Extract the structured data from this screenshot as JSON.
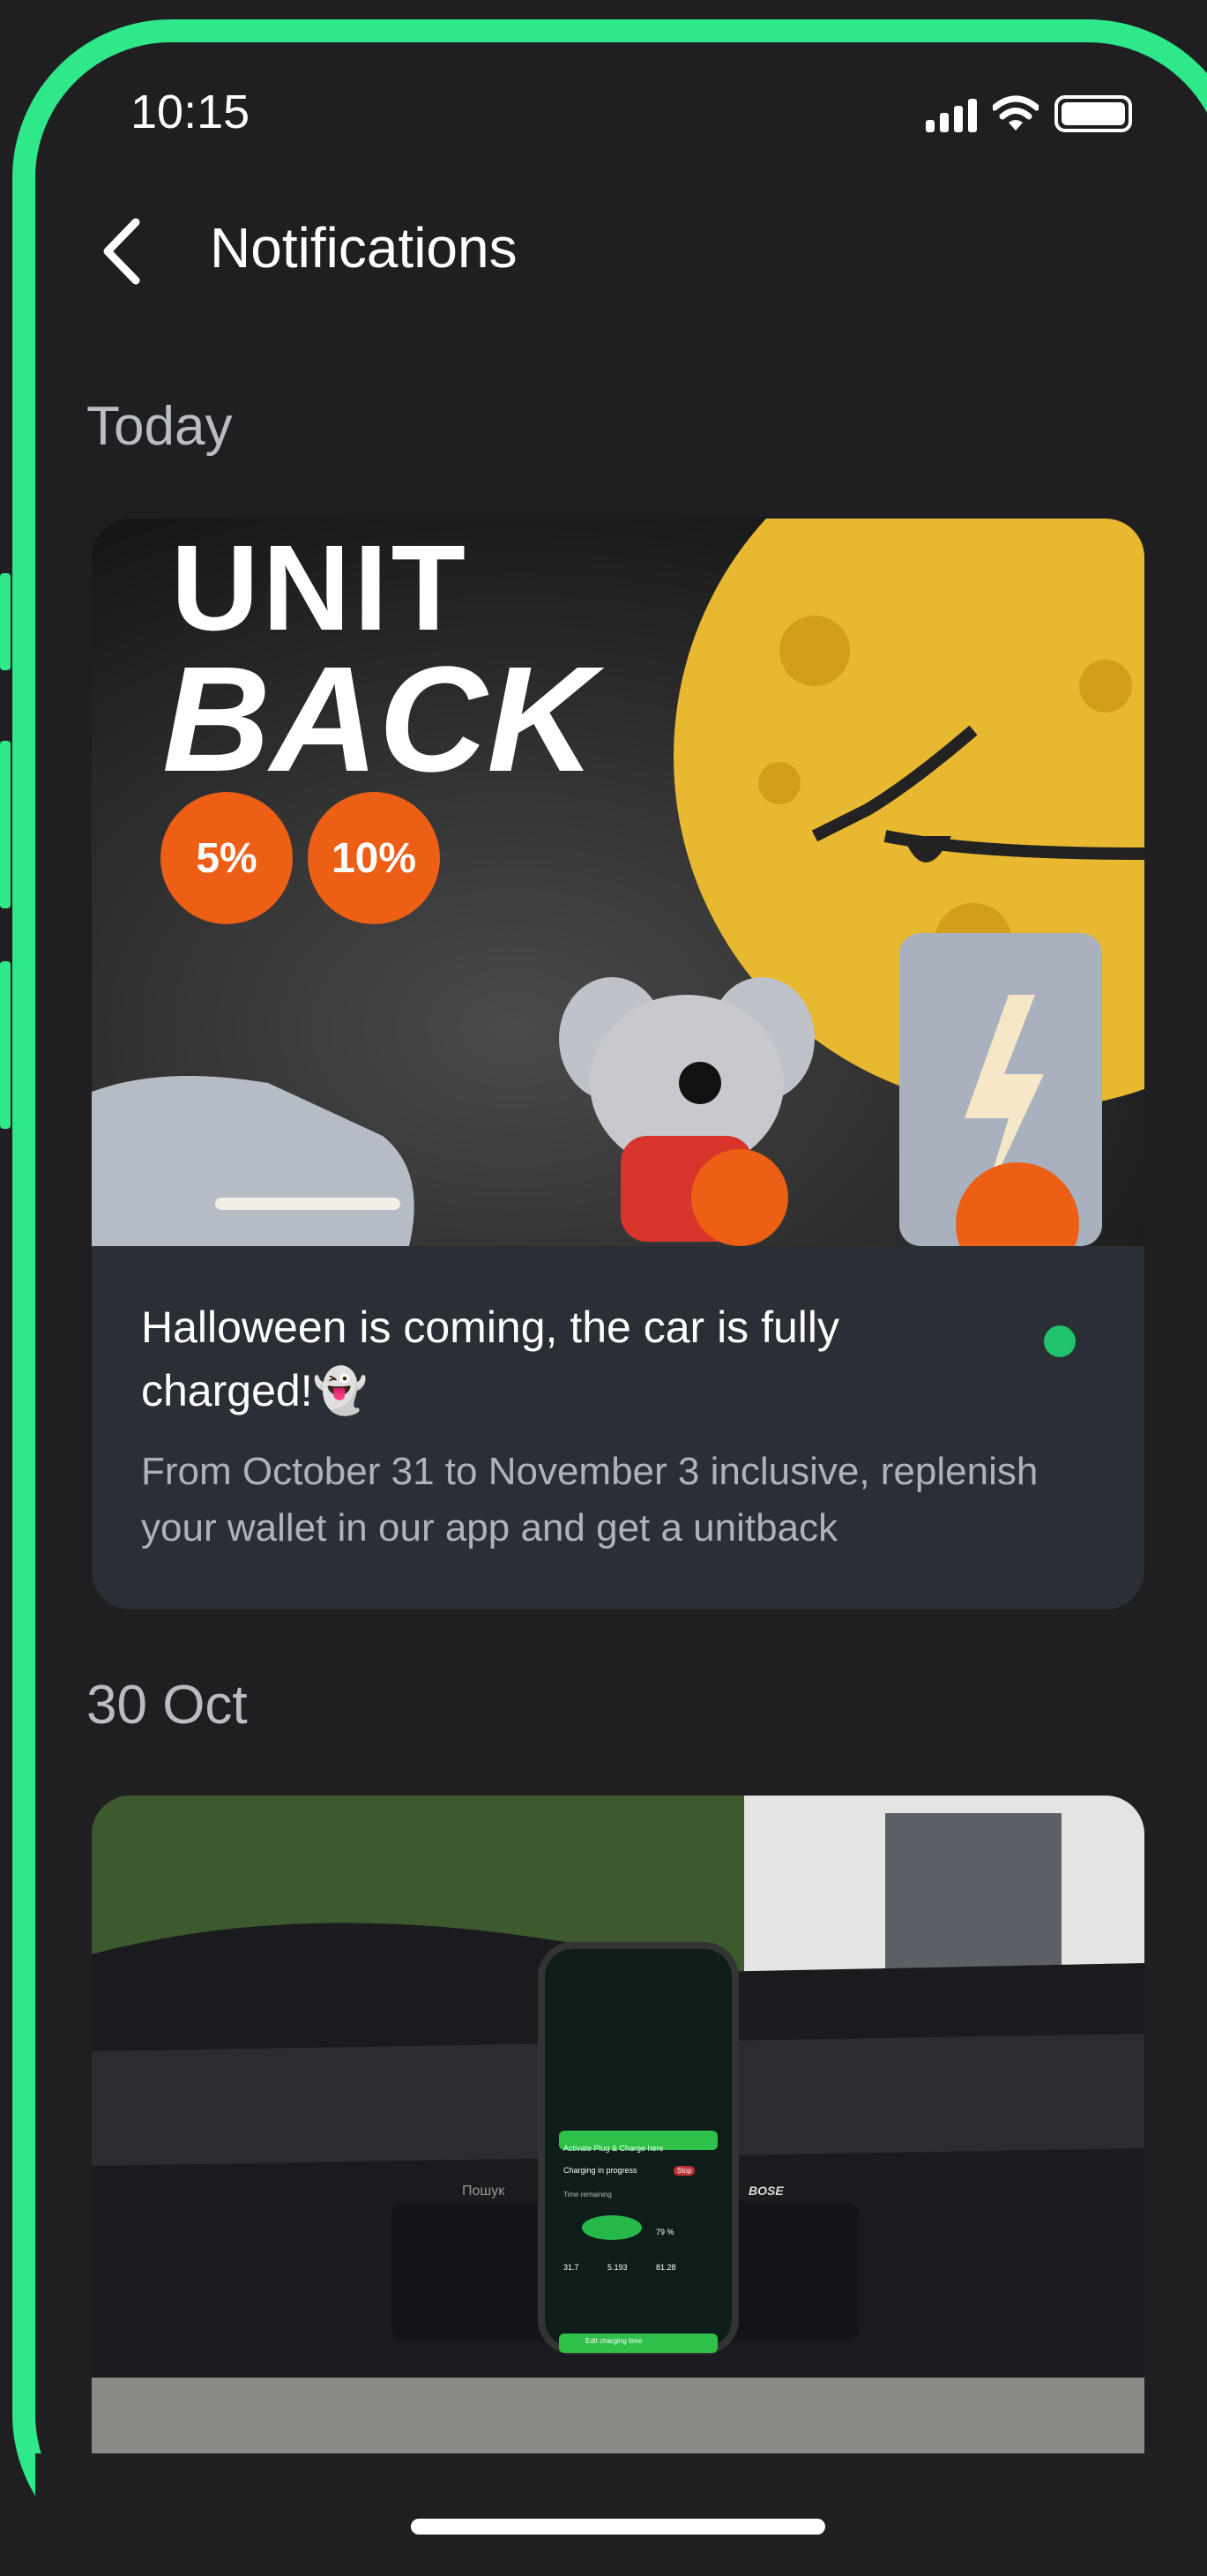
{
  "status": {
    "time": "10:15"
  },
  "header": {
    "title": "Notifications"
  },
  "sections": [
    {
      "label": "Today",
      "notification": {
        "title": "Halloween is coming, the car is fully charged!👻",
        "text": "From October 31 to November 3 inclusive, replenish your wallet in our app and get a unitback",
        "unread": true,
        "banner": {
          "line1": "UNIT",
          "line2": "BACK",
          "pill1": "5%",
          "pill2": "10%"
        }
      }
    },
    {
      "label": "30 Oct",
      "notification": {
        "phone_screen": {
          "activate": "Activate Plug & Charge here",
          "charging": "Charging in progress",
          "time_remaining": "Time remaining",
          "stop": "Stop",
          "battery": "79 %",
          "power": "31.7",
          "consumed": "5.193",
          "cost": "81.28",
          "edit": "Edit charging time",
          "dash_search": "Пошук",
          "dash_brand": "BOSE"
        }
      }
    }
  ],
  "colors": {
    "accent": "#2fe88a",
    "unread": "#21c26c",
    "pill": "#ec5f14",
    "moon": "#e8b830"
  }
}
